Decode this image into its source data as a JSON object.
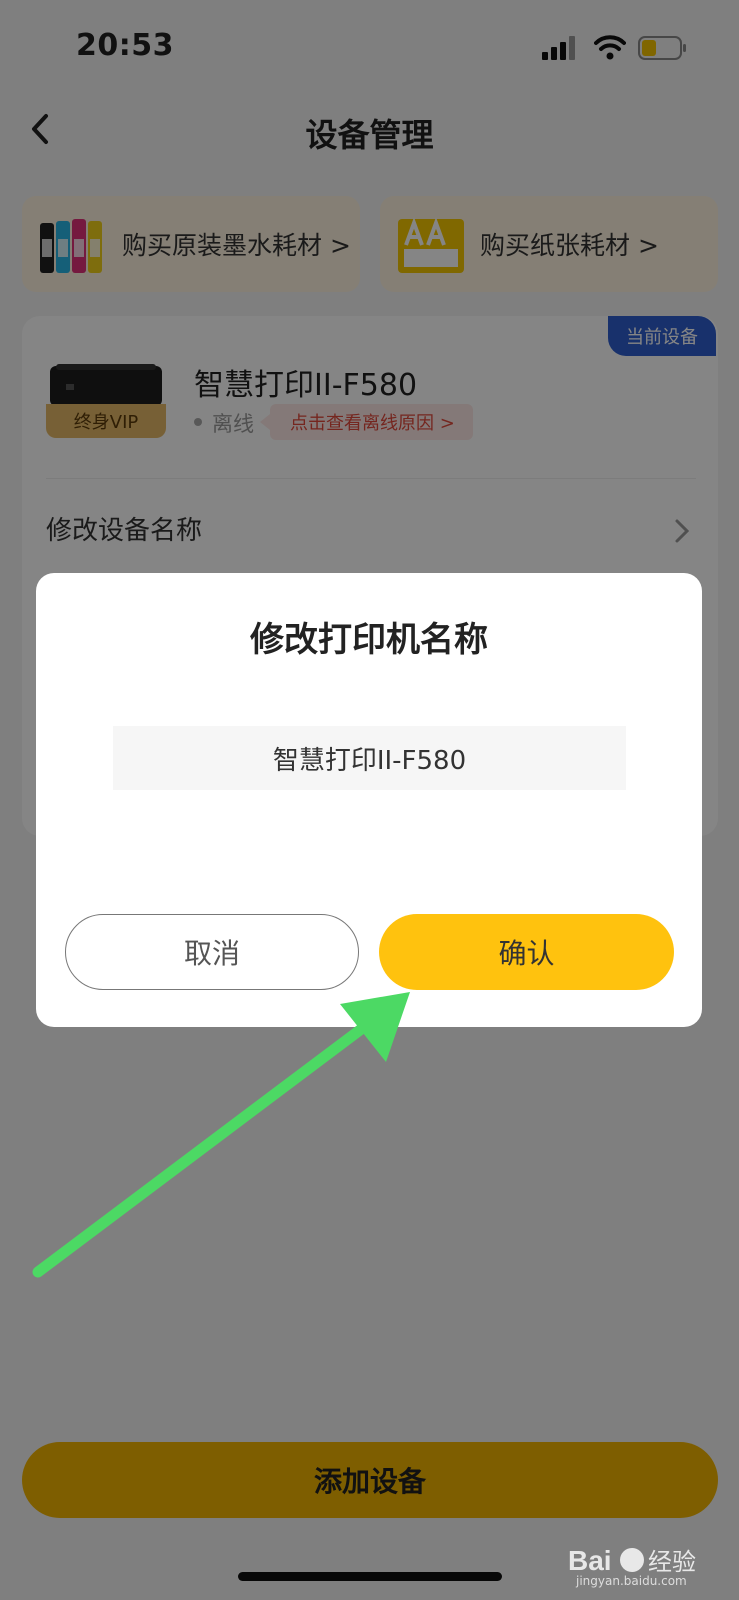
{
  "status_bar": {
    "time": "20:53"
  },
  "nav": {
    "title": "设备管理"
  },
  "promos": {
    "ink": "购买原装墨水耗材 >",
    "paper": "购买纸张耗材 >"
  },
  "device": {
    "current_tag": "当前设备",
    "vip_badge": "终身VIP",
    "name": "智慧打印II-F580",
    "status": "离线",
    "offline_reason": "点击查看离线原因 >",
    "rename_label": "修改设备名称"
  },
  "dialog": {
    "title": "修改打印机名称",
    "input_value": "智慧打印II-F580",
    "cancel": "取消",
    "confirm": "确认"
  },
  "bottom": {
    "add_device": "添加设备"
  },
  "watermark": {
    "brand": "Bai du 经验",
    "url": "jingyan.baidu.com"
  },
  "colors": {
    "accent_yellow": "#ffc20e",
    "tag_blue": "#2f5fd0",
    "annotation_green": "#4cd964"
  }
}
